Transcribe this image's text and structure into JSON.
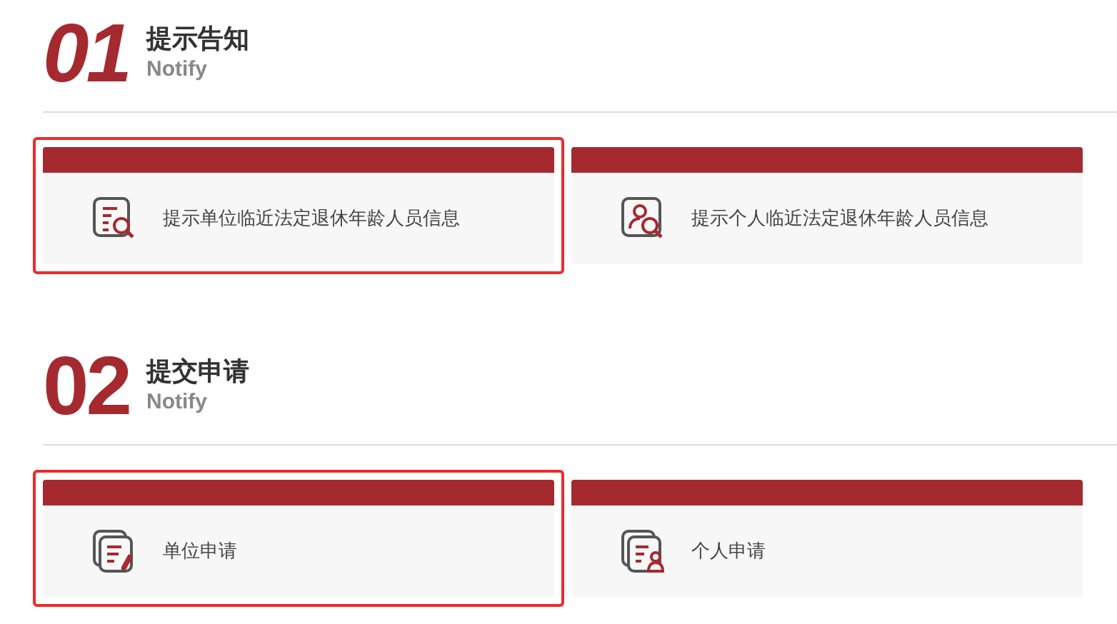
{
  "sections": [
    {
      "number": "01",
      "title": "提示告知",
      "subtitle": "Notify",
      "cards": [
        {
          "kind": "doc-search",
          "label": "提示单位临近法定退休年龄人员信息",
          "selected": true
        },
        {
          "kind": "person-search",
          "label": "提示个人临近法定退休年龄人员信息",
          "selected": false
        }
      ]
    },
    {
      "number": "02",
      "title": "提交申请",
      "subtitle": "Notify",
      "cards": [
        {
          "kind": "docs-edit",
          "label": "单位申请",
          "selected": true
        },
        {
          "kind": "docs-person",
          "label": "个人申请",
          "selected": false
        }
      ]
    }
  ]
}
